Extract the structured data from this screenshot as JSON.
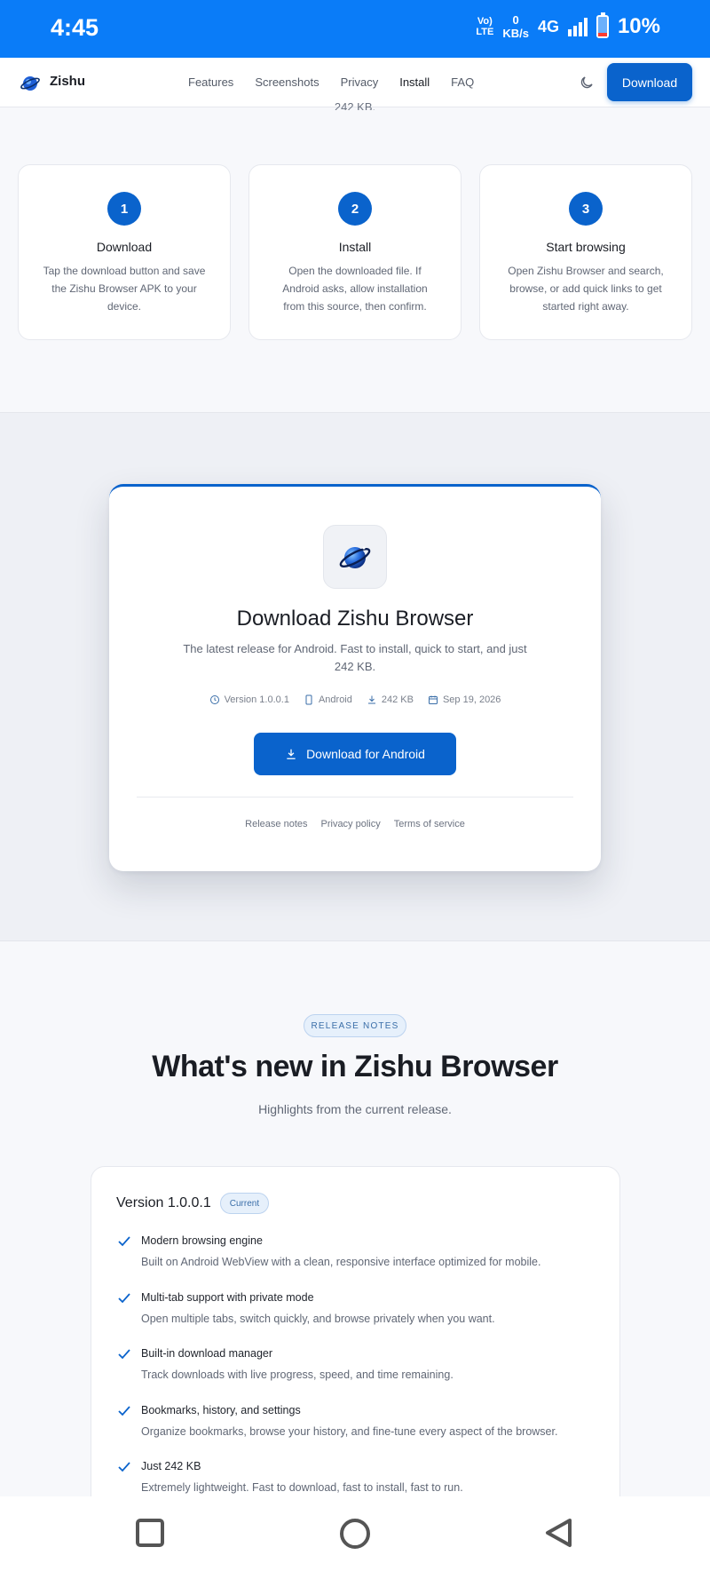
{
  "status_bar": {
    "time": "4:45",
    "volte_top": "Vo)",
    "volte_bottom": "LTE",
    "speed_value": "0",
    "speed_unit": "KB/s",
    "network": "4G",
    "battery_percent": "10%",
    "battery_level": 0.1
  },
  "nav": {
    "brand": "Zishu",
    "links": [
      "Features",
      "Screenshots",
      "Privacy",
      "Install",
      "FAQ"
    ],
    "active_link": "Install",
    "download_label": "Download"
  },
  "cut_text": "242 KB.",
  "steps": [
    {
      "number": "1",
      "title": "Download",
      "text": "Tap the download button and save the Zishu Browser APK to your device."
    },
    {
      "number": "2",
      "title": "Install",
      "text": "Open the downloaded file. If Android asks, allow installation from this source, then confirm."
    },
    {
      "number": "3",
      "title": "Start browsing",
      "text": "Open Zishu Browser and search, browse, or add quick links to get started right away."
    }
  ],
  "download_card": {
    "title": "Download Zishu Browser",
    "subtitle": "The latest release for Android. Fast to install, quick to start, and just 242 KB.",
    "meta": {
      "version": "Version 1.0.0.1",
      "platform": "Android",
      "size": "242 KB",
      "date": "Sep 19, 2026"
    },
    "button_label": "Download for Android",
    "links": [
      "Release notes",
      "Privacy policy",
      "Terms of service"
    ]
  },
  "release_notes": {
    "pill": "RELEASE NOTES",
    "title": "What's new in Zishu Browser",
    "subtitle": "Highlights from the current release.",
    "version": "Version 1.0.0.1",
    "badge": "Current",
    "items": [
      {
        "title": "Modern browsing engine",
        "desc": "Built on Android WebView with a clean, responsive interface optimized for mobile."
      },
      {
        "title": "Multi-tab support with private mode",
        "desc": "Open multiple tabs, switch quickly, and browse privately when you want."
      },
      {
        "title": "Built-in download manager",
        "desc": "Track downloads with live progress, speed, and time remaining."
      },
      {
        "title": "Bookmarks, history, and settings",
        "desc": "Organize bookmarks, browse your history, and fine-tune every aspect of the browser."
      },
      {
        "title": "Just 242 KB",
        "desc": "Extremely lightweight. Fast to download, fast to install, fast to run."
      }
    ]
  },
  "colors": {
    "accent": "#0a63cc",
    "status_bar": "#0a7cf8"
  }
}
